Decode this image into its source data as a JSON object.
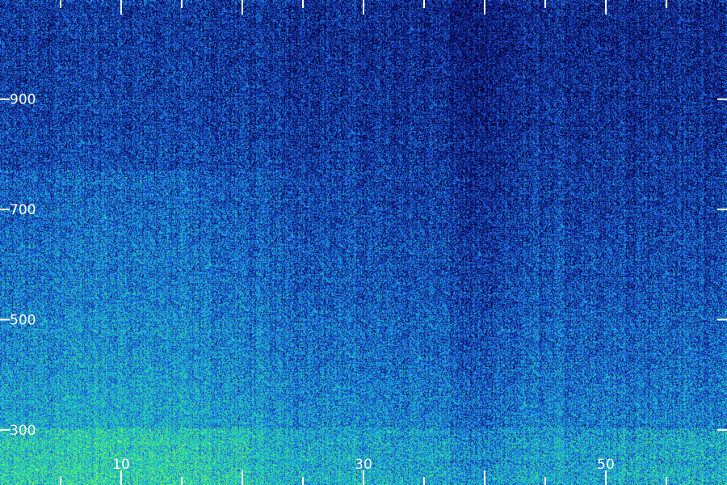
{
  "chart_data": {
    "type": "heatmap",
    "title": "",
    "xlabel": "",
    "ylabel": "",
    "x_ticks": [
      {
        "value": 10,
        "label": "10"
      },
      {
        "value": 30,
        "label": "30"
      },
      {
        "value": 50,
        "label": "50"
      }
    ],
    "y_ticks": [
      {
        "value": 900,
        "label": "900"
      },
      {
        "value": 700,
        "label": "700"
      },
      {
        "value": 500,
        "label": "500"
      },
      {
        "value": 300,
        "label": "300"
      }
    ],
    "xlim": [
      0,
      60
    ],
    "ylim": [
      200,
      1080
    ],
    "x_minor_step": 5,
    "colormap": [
      "#000030",
      "#0a1a7a",
      "#1f4fe0",
      "#1aa6e8",
      "#22d3b0",
      "#3df07a",
      "#a0ff40"
    ],
    "background_color": "#0a1550",
    "tick_color": "#ffffff",
    "grid": false,
    "legend": "none"
  }
}
